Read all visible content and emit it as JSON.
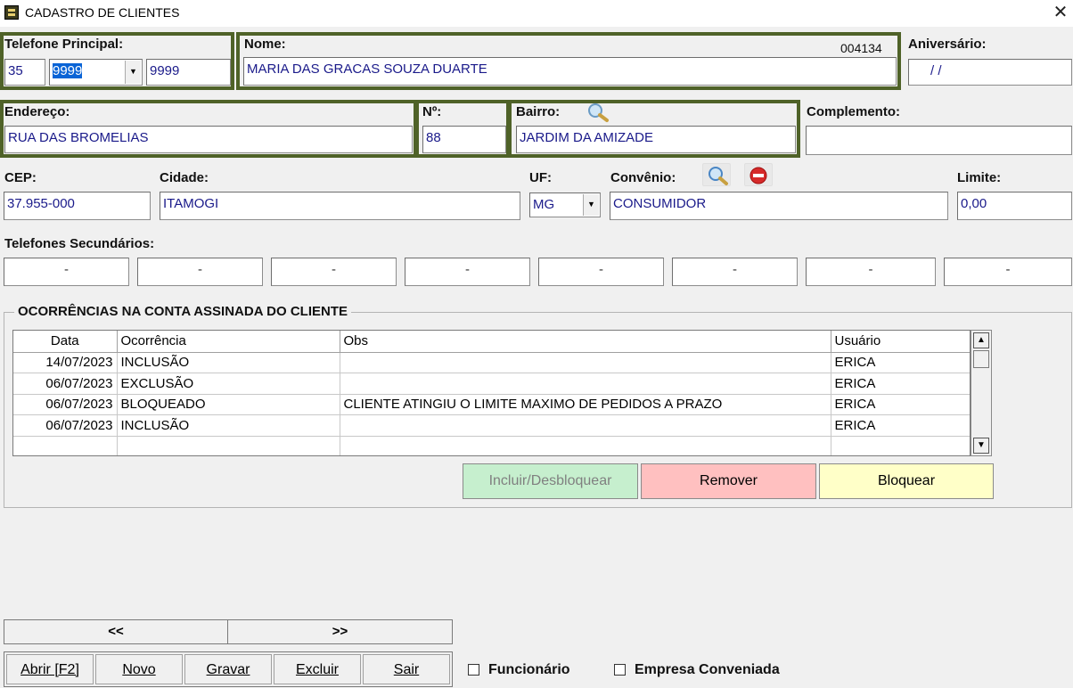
{
  "window": {
    "title": "CADASTRO DE CLIENTES",
    "close_glyph": "✕",
    "icon": "app-icon"
  },
  "telefone_principal": {
    "label": "Telefone Principal:",
    "ddd": "35",
    "prefix": "9999",
    "number": "9999"
  },
  "nome": {
    "label": "Nome:",
    "code": "004134",
    "value": "MARIA DAS GRACAS SOUZA DUARTE"
  },
  "aniversario": {
    "label": "Aniversário:",
    "value": " /  /"
  },
  "endereco": {
    "label": "Endereço:",
    "value": "RUA DAS BROMELIAS"
  },
  "numero": {
    "label": "Nº:",
    "value": "88"
  },
  "bairro": {
    "label": "Bairro:",
    "value": "JARDIM DA AMIZADE",
    "search_icon": "magnifier-icon"
  },
  "complemento": {
    "label": "Complemento:",
    "value": ""
  },
  "cep": {
    "label": "CEP:",
    "value": "37.955-000"
  },
  "cidade": {
    "label": "Cidade:",
    "value": "ITAMOGI"
  },
  "uf": {
    "label": "UF:",
    "value": "MG"
  },
  "convenio": {
    "label": "Convênio:",
    "value": "CONSUMIDOR",
    "search_icon": "magnifier-icon",
    "clear_icon": "red-minus-icon"
  },
  "limite": {
    "label": "Limite:",
    "value": "0,00"
  },
  "telefones_secundarios": {
    "label": "Telefones Secundários:",
    "values": [
      "-",
      "-",
      "-",
      "-",
      "-",
      "-",
      "-",
      "-"
    ]
  },
  "ocorrencias": {
    "title": "OCORRÊNCIAS NA CONTA ASSINADA DO CLIENTE",
    "columns": [
      "Data",
      "Ocorrência",
      "Obs",
      "Usuário"
    ],
    "rows": [
      [
        "14/07/2023",
        "INCLUSÃO",
        "",
        "ERICA"
      ],
      [
        "06/07/2023",
        "EXCLUSÃO",
        "",
        "ERICA"
      ],
      [
        "06/07/2023",
        "BLOQUEADO",
        "CLIENTE ATINGIU O LIMITE MAXIMO DE PEDIDOS A PRAZO",
        "ERICA"
      ],
      [
        "06/07/2023",
        "INCLUSÃO",
        "",
        "ERICA"
      ],
      [
        "",
        "",
        "",
        ""
      ]
    ],
    "buttons": {
      "incluir": "Incluir/Desbloquear",
      "remover": "Remover",
      "bloquear": "Bloquear"
    },
    "colors": {
      "incluir": "#c6efce",
      "remover": "#ffc0c0",
      "bloquear": "#ffffc8",
      "incluir_text": "#808080"
    }
  },
  "nav": {
    "prev": "<<",
    "next": ">>"
  },
  "actions": {
    "abrir": "Abrir [F2]",
    "novo": "Novo",
    "gravar": "Gravar",
    "excluir": "Excluir",
    "sair": "Sair"
  },
  "checks": {
    "funcionario": "Funcionário",
    "empresa": "Empresa Conveniada"
  },
  "accent": {
    "frame": "#4f6228",
    "text": "#1a1a8a"
  }
}
